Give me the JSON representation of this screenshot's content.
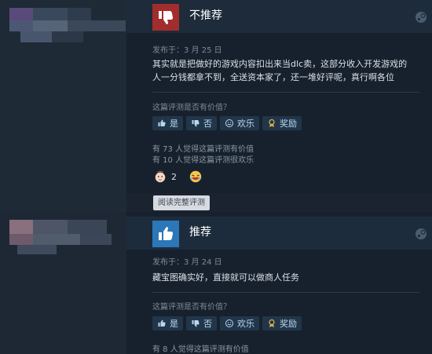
{
  "reviews": [
    {
      "verdict": "不推荐",
      "date": "发布于：3 月 25 日",
      "text_line1": "其实就是把做好的游戏内容扣出来当dlc卖，这部分收入开发游戏的",
      "text_line2": "人一分钱都拿不到，全送资本家了，还一堆好评呢，真行啊各位",
      "question": "这篇评测是否有价值？",
      "buttons": {
        "yes": "是",
        "no": "否",
        "funny": "欢乐",
        "award": "奖励"
      },
      "helpful_text": "有 73 人觉得这篇评测有价值",
      "funny_text": "有 10 人觉得这篇评测很欢乐",
      "award_count": "2",
      "read_full": "阅读完整评测"
    },
    {
      "verdict": "推荐",
      "date": "发布于：3 月 24 日",
      "text_line1": "藏宝图确实好，直接就可以做商人任务",
      "question": "这篇评测是否有价值？",
      "buttons": {
        "yes": "是",
        "no": "否",
        "funny": "欢乐",
        "award": "奖励"
      },
      "helpful_text": "有 8 人觉得这篇评测有价值"
    }
  ],
  "colors": {
    "negative": "#a22d2d",
    "positive": "#2b77b8",
    "panel": "#17212d",
    "accent_text": "#b9d7f0"
  }
}
